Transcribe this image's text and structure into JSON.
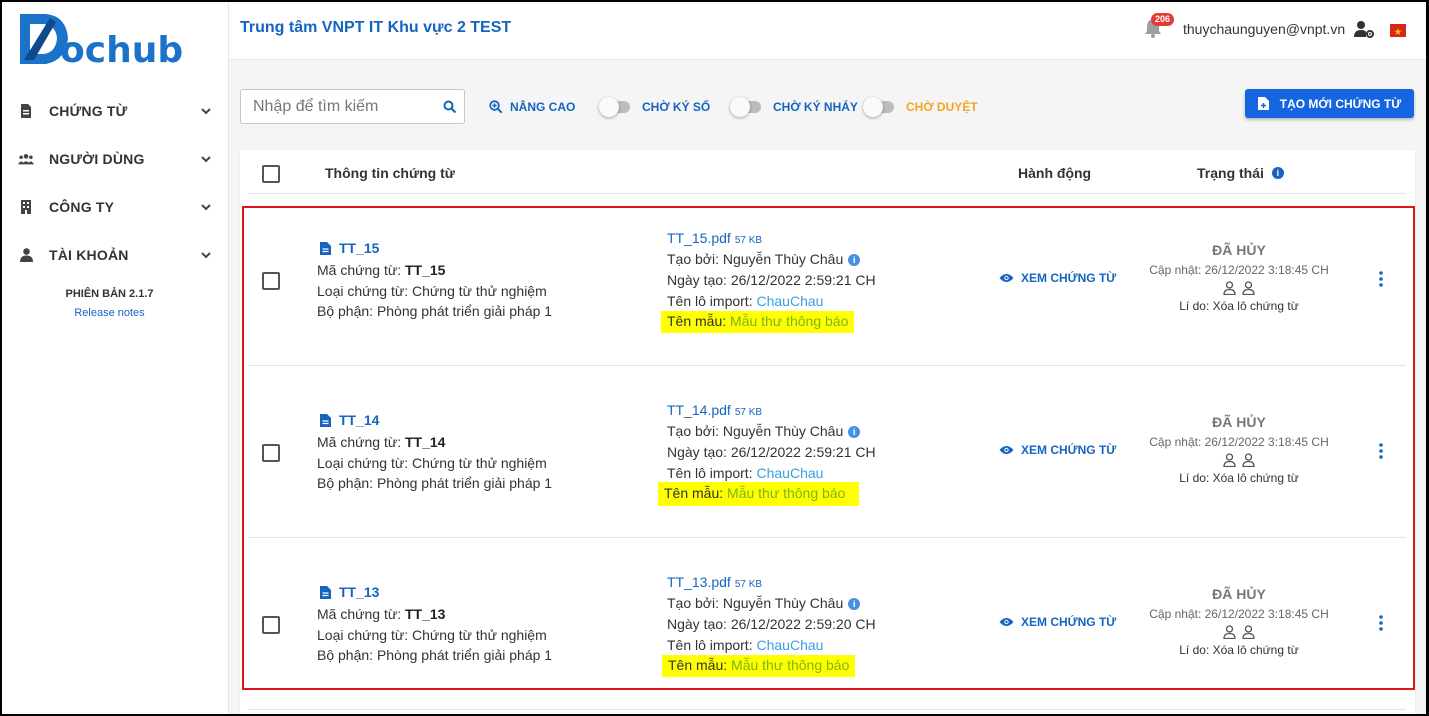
{
  "app": {
    "logo_text": "Dochub"
  },
  "sidebar": {
    "items": [
      {
        "label": "CHỨNG TỪ"
      },
      {
        "label": "NGƯỜI DÙNG"
      },
      {
        "label": "CÔNG TY"
      },
      {
        "label": "TÀI KHOẢN"
      }
    ],
    "version": "PHIÊN BẢN 2.1.7",
    "release_notes": "Release notes"
  },
  "header": {
    "title": "Trung tâm VNPT IT Khu vực 2 TEST",
    "notification_count": "206",
    "user_email": "thuychaunguyen@vnpt.vn"
  },
  "toolbar": {
    "search_placeholder": "Nhập để tìm kiếm",
    "advanced_label": "NÂNG CAO",
    "toggles": [
      {
        "label": "CHỜ KÝ SỐ",
        "color": "#1565c0"
      },
      {
        "label": "CHỜ KÝ NHÁY",
        "color": "#1565c0"
      },
      {
        "label": "CHỜ DUYỆT",
        "color": "#f5a623"
      }
    ],
    "create_label": "TẠO MỚI CHỨNG TỪ"
  },
  "table": {
    "headers": {
      "info": "Thông tin chứng từ",
      "action": "Hành động",
      "status": "Trạng thái"
    },
    "rows": [
      {
        "title": "TT_15",
        "code_label": "Mã chứng từ: ",
        "code": "TT_15",
        "type": "Loại chứng từ: Chứng từ thử nghiệm",
        "dept": "Bộ phận: Phòng phát triển giải pháp 1",
        "file": "TT_15.pdf",
        "size": "57 KB",
        "creator": "Tạo bởi: Nguyễn Thùy Châu",
        "created": "Ngày tạo: 26/12/2022 2:59:21 CH",
        "import_label": "Tên lô import: ",
        "import": "ChauChau",
        "template_label": "Tên mẫu: ",
        "template": "Mẫu thư thông báo",
        "action": "XEM CHỨNG TỪ",
        "status": "ĐÃ HỦY",
        "updated": "Cập nhật: 26/12/2022 3:18:45 CH",
        "reason": "Lí do: Xóa lô chứng từ"
      },
      {
        "title": "TT_14",
        "code_label": "Mã chứng từ: ",
        "code": "TT_14",
        "type": "Loại chứng từ: Chứng từ thử nghiệm",
        "dept": "Bộ phận: Phòng phát triển giải pháp 1",
        "file": "TT_14.pdf",
        "size": "57 KB",
        "creator": "Tạo bởi: Nguyễn Thùy Châu",
        "created": "Ngày tạo: 26/12/2022 2:59:21 CH",
        "import_label": "Tên lô import: ",
        "import": "ChauChau",
        "template_label": "Tên mẫu: ",
        "template": "Mẫu thư thông báo",
        "action": "XEM CHỨNG TỪ",
        "status": "ĐÃ HỦY",
        "updated": "Cập nhật: 26/12/2022 3:18:45 CH",
        "reason": "Lí do: Xóa lô chứng từ"
      },
      {
        "title": "TT_13",
        "code_label": "Mã chứng từ: ",
        "code": "TT_13",
        "type": "Loại chứng từ: Chứng từ thử nghiệm",
        "dept": "Bộ phận: Phòng phát triển giải pháp 1",
        "file": "TT_13.pdf",
        "size": "57 KB",
        "creator": "Tạo bởi: Nguyễn Thùy Châu",
        "created": "Ngày tạo: 26/12/2022 2:59:20 CH",
        "import_label": "Tên lô import: ",
        "import": "ChauChau",
        "template_label": "Tên mẫu: ",
        "template": "Mẫu thư thông báo",
        "action": "XEM CHỨNG TỪ",
        "status": "ĐÃ HỦY",
        "updated": "Cập nhật: 26/12/2022 3:18:45 CH",
        "reason": "Lí do: Xóa lô chứng từ"
      }
    ]
  },
  "colors": {
    "primary": "#1565c0",
    "highlight": "#ffff00",
    "template_value": "#7cb518",
    "danger_border": "#e0141e",
    "badge": "#e53935"
  }
}
